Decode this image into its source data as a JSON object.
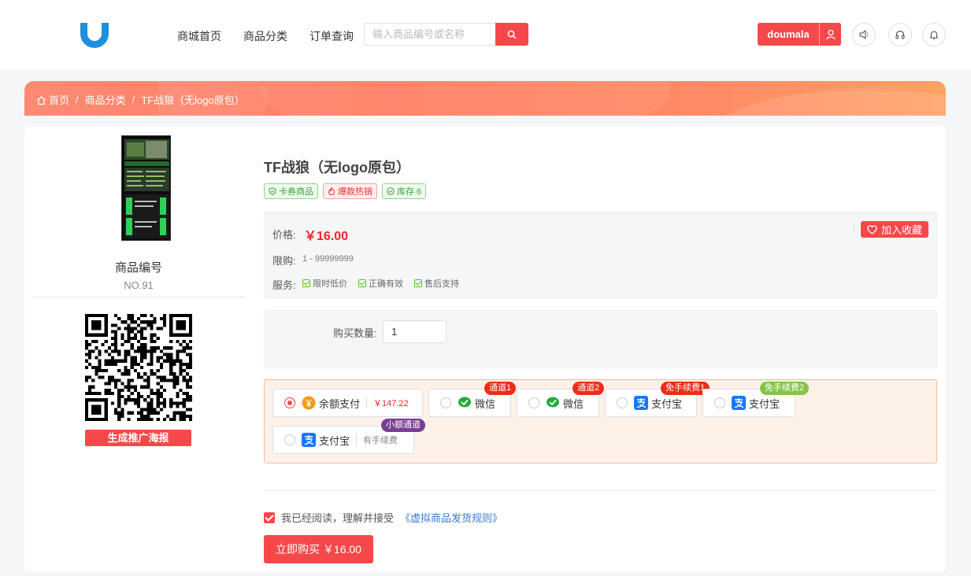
{
  "nav": {
    "home": "商城首页",
    "category": "商品分类",
    "order": "订单查询"
  },
  "search": {
    "placeholder": "输入商品编号或名称"
  },
  "user": {
    "name": "doumala"
  },
  "breadcrumb": {
    "home": "首页",
    "category": "商品分类",
    "current": "TF战狼（无logo原包）",
    "sep": "/"
  },
  "product": {
    "code_label": "商品编号",
    "code": "NO.91",
    "poster_button": "生成推广海报",
    "title": "TF战狼（无logo原包）",
    "tags": {
      "card": "卡券商品",
      "hot": "爆款热销",
      "stock": "库存 6"
    }
  },
  "price_box": {
    "price_label": "价格:",
    "price": "￥16.00",
    "limit_label": "限购:",
    "limit_value": "1 - 99999999",
    "service_label": "服务:",
    "services": [
      "限时低价",
      "正确有效",
      "售后支持"
    ],
    "favorite_button": "加入收藏"
  },
  "quantity": {
    "label": "购买数量:",
    "value": "1"
  },
  "payment": {
    "options": [
      {
        "name": "余额支付",
        "extra": "￥147.22",
        "badge": "",
        "selected": true
      },
      {
        "name": "微信",
        "extra": "",
        "badge": "通道1",
        "selected": false
      },
      {
        "name": "微信",
        "extra": "",
        "badge": "通道2",
        "selected": false
      },
      {
        "name": "支付宝",
        "extra": "",
        "badge": "免手续费1",
        "selected": false
      },
      {
        "name": "支付宝",
        "extra": "",
        "badge": "免手续费2",
        "selected": false
      },
      {
        "name": "支付宝",
        "extra": "有手续费",
        "badge": "小额通道",
        "selected": false
      }
    ]
  },
  "agreement": {
    "text": "我已经阅读，理解并接受",
    "link": "《虚拟商品发货规则》",
    "checked": true
  },
  "buy_button": "立即购买 ￥16.00",
  "colors": {
    "accent": "#f5484a",
    "price": "#f5222d",
    "link": "#3a7bd5",
    "wechat": "#22ac38",
    "alipay": "#1677ff",
    "balance": "#f39c12"
  }
}
